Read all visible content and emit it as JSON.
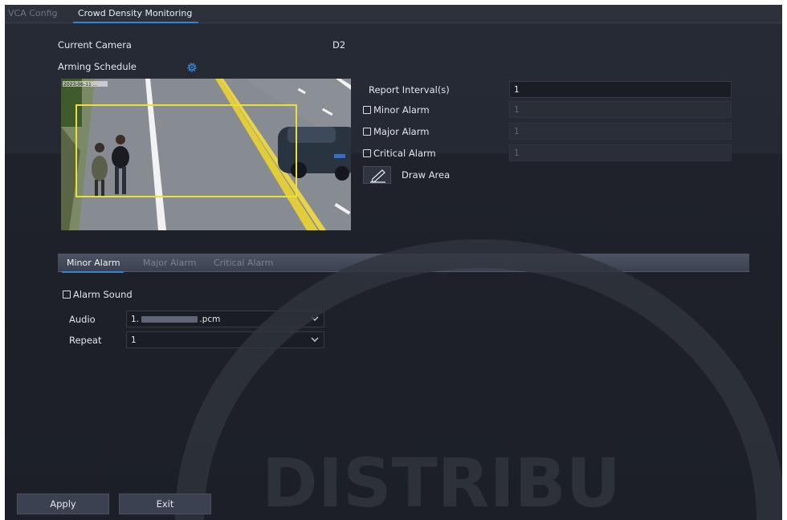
{
  "tabs": [
    {
      "label": "VCA Config",
      "active": false
    },
    {
      "label": "Crowd Density Monitoring",
      "active": true
    }
  ],
  "current_camera": {
    "label": "Current Camera",
    "value": "D2"
  },
  "arming_schedule": {
    "label": "Arming Schedule",
    "icon": "gear-icon"
  },
  "preview": {
    "timestamp_overlay": "2023-06-11 ..."
  },
  "report_interval": {
    "label": "Report Interval(s)",
    "value": "1"
  },
  "thresholds": [
    {
      "label": "Minor Alarm",
      "checked": false,
      "value": "1"
    },
    {
      "label": "Major Alarm",
      "checked": false,
      "value": "1"
    },
    {
      "label": "Critical Alarm",
      "checked": false,
      "value": "1"
    }
  ],
  "draw_area": {
    "label": "Draw Area",
    "icon": "pencil-icon"
  },
  "alarm_tabs": [
    {
      "label": "Minor Alarm",
      "active": true
    },
    {
      "label": "Major Alarm",
      "active": false
    },
    {
      "label": "Critical Alarm",
      "active": false
    }
  ],
  "alarm_sound": {
    "label": "Alarm Sound",
    "checked": false
  },
  "audio": {
    "label": "Audio",
    "prefix": "1.",
    "suffix": ".pcm"
  },
  "repeat": {
    "label": "Repeat",
    "value": "1"
  },
  "buttons": {
    "apply": "Apply",
    "exit": "Exit"
  },
  "watermark_text": "DISTRIBU",
  "colors": {
    "accent": "#2e86d6",
    "roi": "#ecdf3a",
    "background": "#1f222a"
  }
}
